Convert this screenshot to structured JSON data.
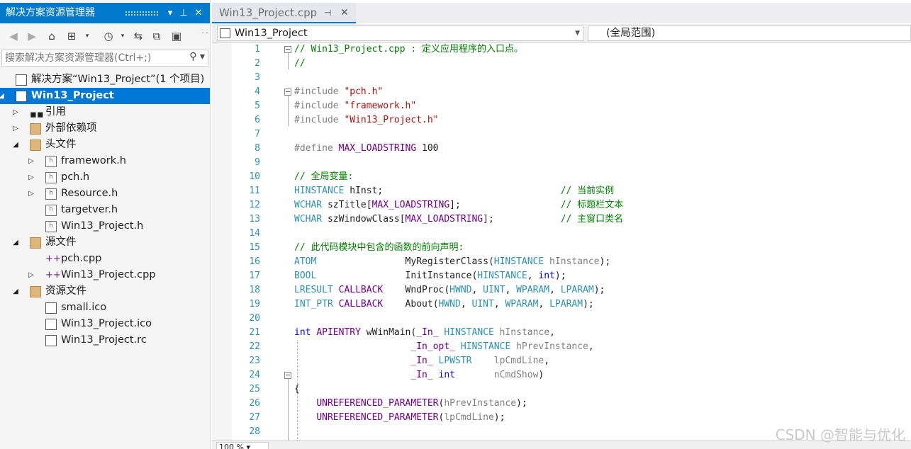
{
  "solution_explorer": {
    "title": "解决方案资源管理器",
    "search_placeholder": "搜索解决方案资源管理器(Ctrl+;)",
    "tree": [
      {
        "label": "解决方案“Win13_Project”(1 个项目)",
        "icon": "solution-icon",
        "expander": "",
        "depth": 0
      },
      {
        "label": "Win13_Project",
        "icon": "cpp-project-icon",
        "expander": "expanded",
        "depth": 0,
        "selected": true
      },
      {
        "label": "引用",
        "icon": "references-icon",
        "expander": "collapsed",
        "depth": 1
      },
      {
        "label": "外部依赖项",
        "icon": "external-deps-icon",
        "expander": "collapsed",
        "depth": 1
      },
      {
        "label": "头文件",
        "icon": "folder-icon",
        "expander": "expanded",
        "depth": 1
      },
      {
        "label": "framework.h",
        "icon": "header-file-icon",
        "expander": "collapsed",
        "depth": 2
      },
      {
        "label": "pch.h",
        "icon": "header-file-icon",
        "expander": "collapsed",
        "depth": 2
      },
      {
        "label": "Resource.h",
        "icon": "header-file-icon",
        "expander": "collapsed",
        "depth": 2
      },
      {
        "label": "targetver.h",
        "icon": "header-file-icon",
        "expander": "",
        "depth": 2
      },
      {
        "label": "Win13_Project.h",
        "icon": "header-file-icon",
        "expander": "",
        "depth": 2
      },
      {
        "label": "源文件",
        "icon": "folder-icon",
        "expander": "expanded",
        "depth": 1
      },
      {
        "label": "pch.cpp",
        "icon": "cpp-file-icon",
        "expander": "",
        "depth": 2
      },
      {
        "label": "Win13_Project.cpp",
        "icon": "cpp-file-icon",
        "expander": "collapsed",
        "depth": 2
      },
      {
        "label": "资源文件",
        "icon": "folder-icon",
        "expander": "expanded",
        "depth": 1
      },
      {
        "label": "small.ico",
        "icon": "image-file-icon",
        "expander": "",
        "depth": 2
      },
      {
        "label": "Win13_Project.ico",
        "icon": "image-file-icon",
        "expander": "",
        "depth": 2
      },
      {
        "label": "Win13_Project.rc",
        "icon": "resource-file-icon",
        "expander": "",
        "depth": 2
      }
    ]
  },
  "editor": {
    "tab_label": "Win13_Project.cpp",
    "nav_project": "Win13_Project",
    "nav_scope": "(全局范围)",
    "zoom": "100 %",
    "lines": [
      {
        "n": "1",
        "fold": true,
        "html": "<span class='cm'>// Win13_Project.cpp : 定义应用程序的入口点。</span>"
      },
      {
        "n": "2",
        "html": "<span class='cm'>//</span>"
      },
      {
        "n": "3",
        "html": ""
      },
      {
        "n": "4",
        "fold": true,
        "html": "<span class='pp'>#include</span> <span class='str'>\"pch.h\"</span>"
      },
      {
        "n": "5",
        "html": "<span class='pp'>#include</span> <span class='str'>\"framework.h\"</span>"
      },
      {
        "n": "6",
        "html": "<span class='pp'>#include</span> <span class='str'>\"Win13_Project.h\"</span>"
      },
      {
        "n": "7",
        "html": ""
      },
      {
        "n": "8",
        "html": "<span class='pp'>#define</span> <span class='mc'>MAX_LOADSTRING</span> 100"
      },
      {
        "n": "9",
        "html": ""
      },
      {
        "n": "10",
        "html": "<span class='cm'>// 全局变量:</span>"
      },
      {
        "n": "11",
        "html": "<span class='ty'>HINSTANCE</span> hInst;                                <span class='cm'>// 当前实例</span>"
      },
      {
        "n": "12",
        "html": "<span class='ty'>WCHAR</span> szTitle[<span class='mc'>MAX_LOADSTRING</span>];                  <span class='cm'>// 标题栏文本</span>"
      },
      {
        "n": "13",
        "html": "<span class='ty'>WCHAR</span> szWindowClass[<span class='mc'>MAX_LOADSTRING</span>];            <span class='cm'>// 主窗口类名</span>"
      },
      {
        "n": "14",
        "html": ""
      },
      {
        "n": "15",
        "html": "<span class='cm'>// 此代码模块中包含的函数的前向声明:</span>"
      },
      {
        "n": "16",
        "html": "<span class='ty'>ATOM</span>                MyRegisterClass(<span class='ty'>HINSTANCE</span> <span class='pa'>hInstance</span>);"
      },
      {
        "n": "17",
        "html": "<span class='ty'>BOOL</span>                InitInstance(<span class='ty'>HINSTANCE</span>, <span class='kw'>int</span>);"
      },
      {
        "n": "18",
        "html": "<span class='ty'>LRESULT</span> <span class='mc'>CALLBACK</span>    WndProc(<span class='ty'>HWND</span>, <span class='ty'>UINT</span>, <span class='ty'>WPARAM</span>, <span class='ty'>LPARAM</span>);"
      },
      {
        "n": "19",
        "html": "<span class='ty'>INT_PTR</span> <span class='mc'>CALLBACK</span>    About(<span class='ty'>HWND</span>, <span class='ty'>UINT</span>, <span class='ty'>WPARAM</span>, <span class='ty'>LPARAM</span>);"
      },
      {
        "n": "20",
        "html": ""
      },
      {
        "n": "21",
        "html": "<span class='kw'>int</span> <span class='mc'>APIENTRY</span> wWinMain(<span class='mc'>_In_</span> <span class='ty'>HINSTANCE</span> <span class='pa'>hInstance</span>,"
      },
      {
        "n": "22",
        "html": "                     <span class='mc'>_In_opt_</span> <span class='ty'>HINSTANCE</span> <span class='pa'>hPrevInstance</span>,"
      },
      {
        "n": "23",
        "html": "                     <span class='mc'>_In_</span> <span class='ty'>LPWSTR</span>    <span class='pa'>lpCmdLine</span>,"
      },
      {
        "n": "24",
        "fold": true,
        "html": "                     <span class='mc'>_In_</span> <span class='kw'>int</span>       <span class='pa'>nCmdShow</span>)"
      },
      {
        "n": "25",
        "html": "{"
      },
      {
        "n": "26",
        "html": "    <span class='mc'>UNREFERENCED_PARAMETER</span>(<span class='pa'>hPrevInstance</span>);"
      },
      {
        "n": "27",
        "html": "    <span class='mc'>UNREFERENCED_PARAMETER</span>(<span class='pa'>lpCmdLine</span>);"
      },
      {
        "n": "28",
        "html": ""
      }
    ]
  },
  "watermark": "CSDN @智能与优化"
}
